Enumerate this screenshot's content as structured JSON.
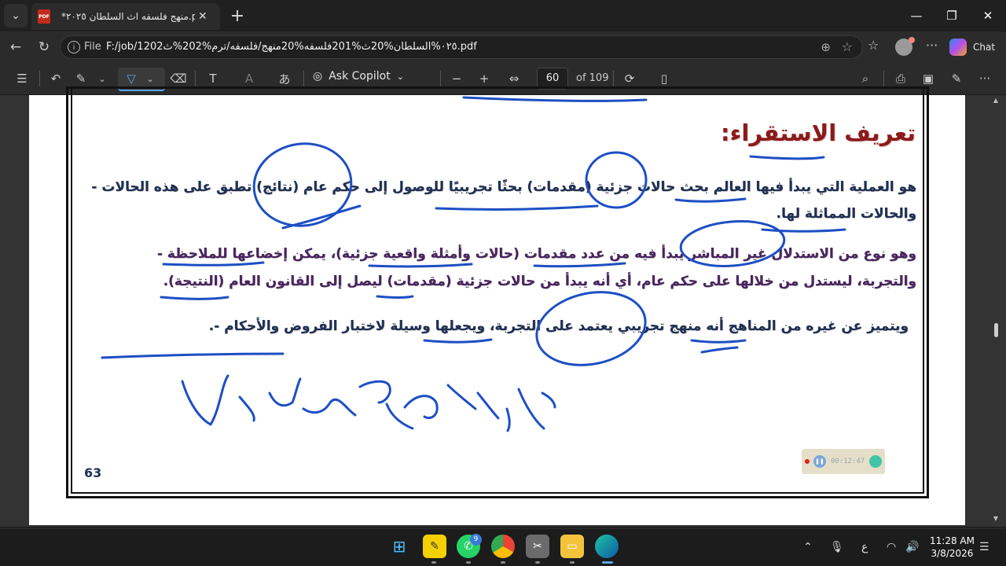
{
  "browser": {
    "tab_title": "*منهج فلسفه اث السلطان ٢٠٢٥.pdf",
    "address_prefix": "File",
    "url": "F:/job/1202٠٢٥%السلطان%20ث%201فلسفه%20منهج/فلسفه/ترم%202%ث.pdf",
    "chat_label": "Chat"
  },
  "pdf_toolbar": {
    "ask_copilot": "Ask Copilot",
    "page_number": "60",
    "page_total": "of 109"
  },
  "document": {
    "heading": "تعريف الاستقراء:",
    "para1_line1": "هو العملية التي يبدأ فيها العالم بحث حالات جزئية (مقدمات) بحثًا تجريبيًا للوصول إلى حكم عام (نتائج) تطبق على هذه الحالات -",
    "para1_line2": "والحالات المماثلة لها.",
    "para2_line1": "وهو نوع من الاستدلال غير المباشر يبدأ فيه من عدد مقدمات (حالات وأمثلة واقعية جزئية)، يمكن إخضاعها للملاحظة -",
    "para2_line2": "والتجربة، ليستدل من خلالها على حكم عام، أي أنه يبدأ من حالات جزئية (مقدمات) ليصل إلى القانون العام (النتيجة).",
    "para3_line1": "ويتميز عن غيره من المناهج أنه منهج تجريبي يعتمد على التجربة، ويجعلها وسيلة لاختبار الفروض والأحكام -.",
    "page_number": "63"
  },
  "recorder": {
    "time": "00:12:47"
  },
  "taskbar": {
    "whatsapp_badge": "9",
    "language": "ع",
    "time": "11:28 AM",
    "date": "3/8/2026"
  },
  "colors": {
    "ink": "#1d4fc4",
    "heading": "#8b1a1a",
    "text_navy": "#1f2f55",
    "text_purple": "#4a2460"
  }
}
